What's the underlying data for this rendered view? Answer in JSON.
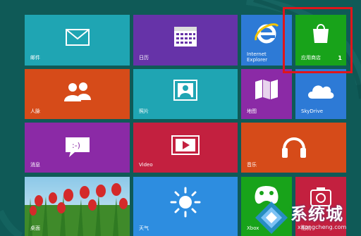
{
  "colors": {
    "background": "#0f5a57",
    "highlight_border": "#e0151b"
  },
  "tiles": [
    {
      "id": "mail",
      "label": "邮件",
      "color": "#1fa5b3",
      "icon": "envelope-icon"
    },
    {
      "id": "calendar",
      "label": "日历",
      "color": "#6633a8",
      "icon": "calendar-icon"
    },
    {
      "id": "ie",
      "label": "Internet\nExplorer",
      "color": "#2d7ad6",
      "icon": "internet-explorer-icon"
    },
    {
      "id": "store",
      "label": "应用商店",
      "color": "#18a31a",
      "icon": "shopping-bag-icon",
      "badge": "1"
    },
    {
      "id": "people",
      "label": "人脉",
      "color": "#d64b19",
      "icon": "people-icon"
    },
    {
      "id": "photos",
      "label": "照片",
      "color": "#1fa5b3",
      "icon": "photo-icon"
    },
    {
      "id": "maps",
      "label": "地图",
      "color": "#8b2aa6",
      "icon": "map-icon"
    },
    {
      "id": "skydrive",
      "label": "SkyDrive",
      "color": "#2d7ad6",
      "icon": "cloud-icon"
    },
    {
      "id": "messaging",
      "label": "消息",
      "color": "#8b2aa6",
      "icon": "chat-bubble-icon"
    },
    {
      "id": "video",
      "label": "Video",
      "color": "#c3203f",
      "icon": "play-icon"
    },
    {
      "id": "music",
      "label": "音乐",
      "color": "#d64b19",
      "icon": "headphones-icon"
    },
    {
      "id": "desktop",
      "label": "桌面",
      "color": "#5aa0c8",
      "icon": "desktop-wallpaper"
    },
    {
      "id": "weather",
      "label": "天气",
      "color": "#2d8de0",
      "icon": "sun-icon"
    },
    {
      "id": "xbox",
      "label": "Xbox",
      "color": "#18a31a",
      "icon": "xbox-controller-icon"
    },
    {
      "id": "camera",
      "label": "相机",
      "color": "#c3203f",
      "icon": "camera-icon"
    }
  ],
  "watermark": {
    "text": "系统城",
    "url": "xitongcheng.com",
    "icon": "logo-icon"
  }
}
